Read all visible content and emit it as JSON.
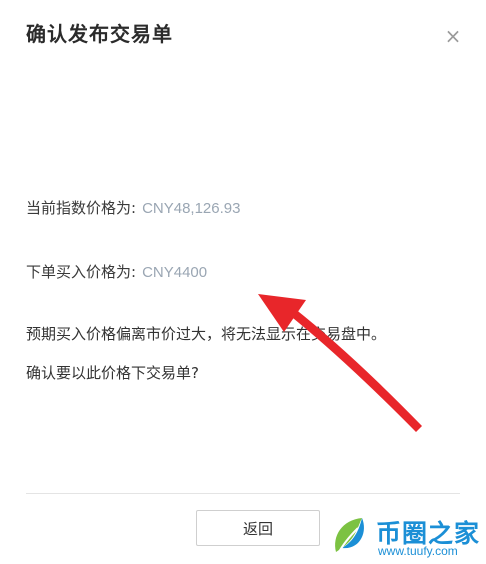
{
  "dialog": {
    "title": "确认发布交易单",
    "close_symbol": "×",
    "index_price_label": "当前指数价格为:",
    "index_price_value": "CNY48,126.93",
    "order_price_label": "下单买入价格为:",
    "order_price_value": "CNY4400",
    "warning_text": "预期买入价格偏离市价过大，将无法显示在交易盘中。",
    "confirm_question": "确认要以此价格下交易单?",
    "back_button_label": "返回"
  },
  "annotation": {
    "arrow_color": "#e8262a"
  },
  "watermark": {
    "brand_text": "币圈之家",
    "url_text": "www.tuufy.com",
    "brand_color": "#1b8fd6"
  }
}
